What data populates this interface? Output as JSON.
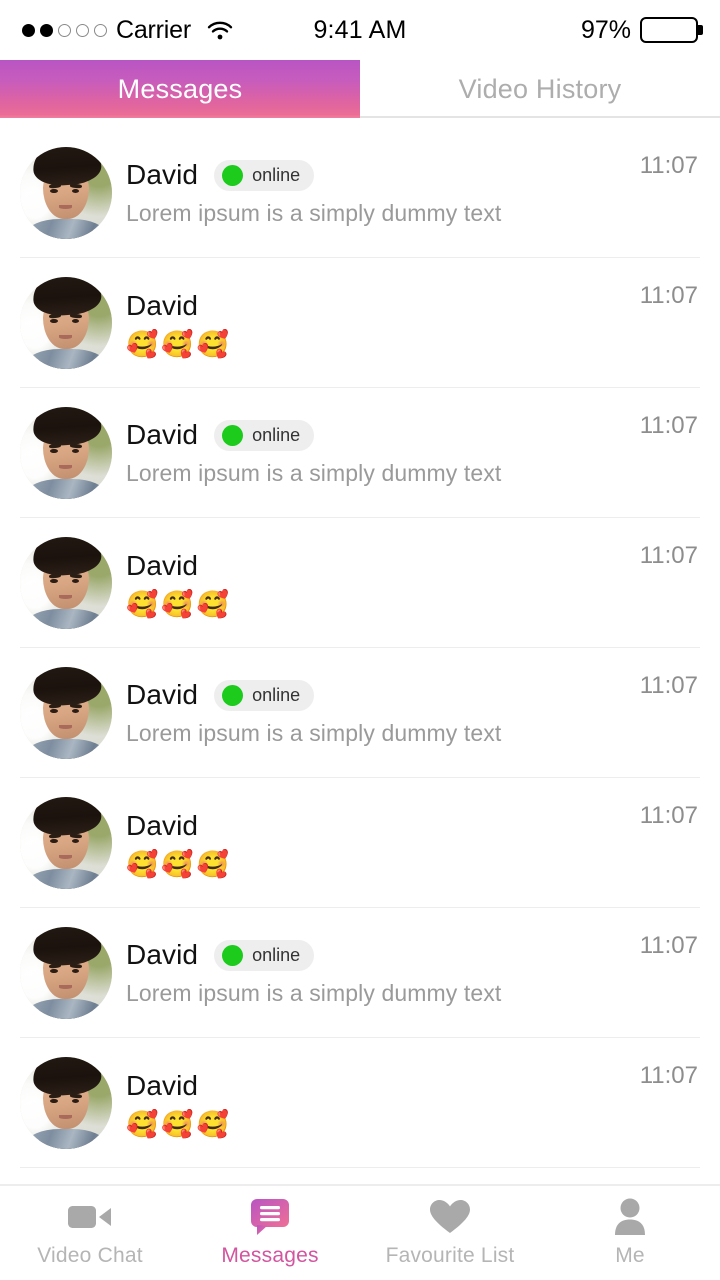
{
  "status_bar": {
    "signal_dots_filled": 2,
    "signal_dots_total": 5,
    "carrier": "Carrier",
    "wifi_icon": "wifi-icon",
    "time": "9:41 AM",
    "battery_percent": "97%",
    "battery_level": 97
  },
  "top_tabs": {
    "active_index": 0,
    "items": [
      {
        "label": "Messages"
      },
      {
        "label": "Video History"
      }
    ],
    "active_gradient_from": "#b855c4",
    "active_gradient_to": "#ef6f95",
    "inactive_color": "#adadad"
  },
  "conversations": [
    {
      "name": "David",
      "status": "online",
      "snippet": "Lorem ipsum is a simply dummy text",
      "time": "11:07",
      "type": "text"
    },
    {
      "name": "David",
      "status": "",
      "snippet": "🥰🥰🥰",
      "time": "11:07",
      "type": "emoji"
    },
    {
      "name": "David",
      "status": "online",
      "snippet": "Lorem ipsum is a simply dummy text",
      "time": "11:07",
      "type": "text"
    },
    {
      "name": "David",
      "status": "",
      "snippet": "🥰🥰🥰",
      "time": "11:07",
      "type": "emoji"
    },
    {
      "name": "David",
      "status": "online",
      "snippet": "Lorem ipsum is a simply dummy text",
      "time": "11:07",
      "type": "text"
    },
    {
      "name": "David",
      "status": "",
      "snippet": "🥰🥰🥰",
      "time": "11:07",
      "type": "emoji"
    },
    {
      "name": "David",
      "status": "online",
      "snippet": "Lorem ipsum is a simply dummy text",
      "time": "11:07",
      "type": "text"
    },
    {
      "name": "David",
      "status": "",
      "snippet": "🥰🥰🥰",
      "time": "11:07",
      "type": "emoji"
    }
  ],
  "status_badge": {
    "dot_color": "#1ccb1c",
    "pill_bg": "#eeeeee"
  },
  "bottom_nav": {
    "active_index": 1,
    "active_color": "#d2559f",
    "inactive_color": "#b5b5b5",
    "items": [
      {
        "label": "Video Chat",
        "icon": "video-camera-icon"
      },
      {
        "label": "Messages",
        "icon": "chat-bubble-icon"
      },
      {
        "label": "Favourite List",
        "icon": "heart-icon"
      },
      {
        "label": "Me",
        "icon": "person-icon"
      }
    ]
  }
}
